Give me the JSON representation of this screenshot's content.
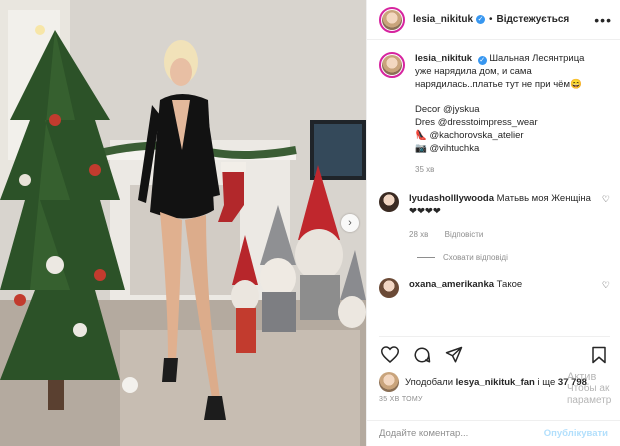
{
  "post": {
    "username": "lesia_nikituk",
    "follow_status": "Відстежується",
    "caption": {
      "line1": "Шальная Лесянтрица",
      "line2": "уже нарядила дом, и сама",
      "line3": "нарядилась..платье тут не при чём😄",
      "decor": "Decor @jyskua",
      "dress": "Dres @dresstoimpress_wear",
      "shoes": "👠 @kachorovska_atelier",
      "photo": "📷 @vihtuchka",
      "time": "35 хв"
    },
    "comments": [
      {
        "username": "lyudasholllywooda",
        "text": "Матьвь моя Женщіна ❤❤❤❤",
        "time": "28 хв",
        "reply": "Відповісти"
      },
      {
        "username": "oxana_amerikanka",
        "text": "Такое"
      }
    ],
    "hide_replies": "Сховати відповіді",
    "likes": {
      "prefix": "Уподобали",
      "user": "lesya_nikituk_fan",
      "middle": "і ще",
      "count": "37 798"
    },
    "posted_ago": "35 ХВ ТОМУ",
    "add_comment_placeholder": "Додайте коментар...",
    "publish_label": "Опублікувати"
  },
  "watermark": {
    "line1": "Актив",
    "line2": "Чтобы ак",
    "line3": "параметр"
  },
  "icons": {
    "more": "more-icon",
    "verified": "verified-badge-icon",
    "heart": "heart-icon",
    "comment": "comment-icon",
    "share": "share-icon",
    "bookmark": "bookmark-icon",
    "next": "chevron-right-icon"
  },
  "colors": {
    "accent": "#3897f0",
    "muted": "#8e8e8e",
    "publish": "#b2dffc",
    "story_ring": "#d6249f"
  }
}
